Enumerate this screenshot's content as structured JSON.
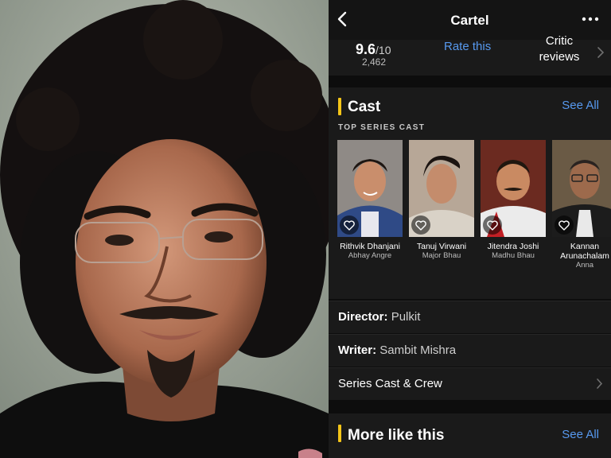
{
  "header": {
    "title": "Cartel",
    "back_icon": "chevron-left-icon",
    "more_icon": "ellipsis-icon"
  },
  "ratings": {
    "score": "9.6",
    "max": "/10",
    "count": "2,462",
    "rate_label": "Rate this",
    "critic_label_line1": "Critic",
    "critic_label_line2": "reviews"
  },
  "cast": {
    "title": "Cast",
    "see_all": "See All",
    "subheading": "TOP SERIES CAST",
    "members": [
      {
        "name": "Rithvik Dhanjani",
        "role": "Abhay Angre"
      },
      {
        "name": "Tanuj Virwani",
        "role": "Major Bhau"
      },
      {
        "name": "Jitendra Joshi",
        "role": "Madhu Bhau"
      },
      {
        "name": "Kannan Arunachalam",
        "role": "Anna"
      }
    ]
  },
  "credits": {
    "director_label": "Director:",
    "director_value": "Pulkit",
    "writer_label": "Writer:",
    "writer_value": "Sambit Mishra",
    "cast_crew_label": "Series Cast & Crew"
  },
  "more_like_this": {
    "title": "More like this",
    "see_all": "See All"
  },
  "colors": {
    "accent_yellow": "#f5c518",
    "link_blue": "#5799ef",
    "panel": "#1a1a1a",
    "background": "#0d0d0d"
  }
}
